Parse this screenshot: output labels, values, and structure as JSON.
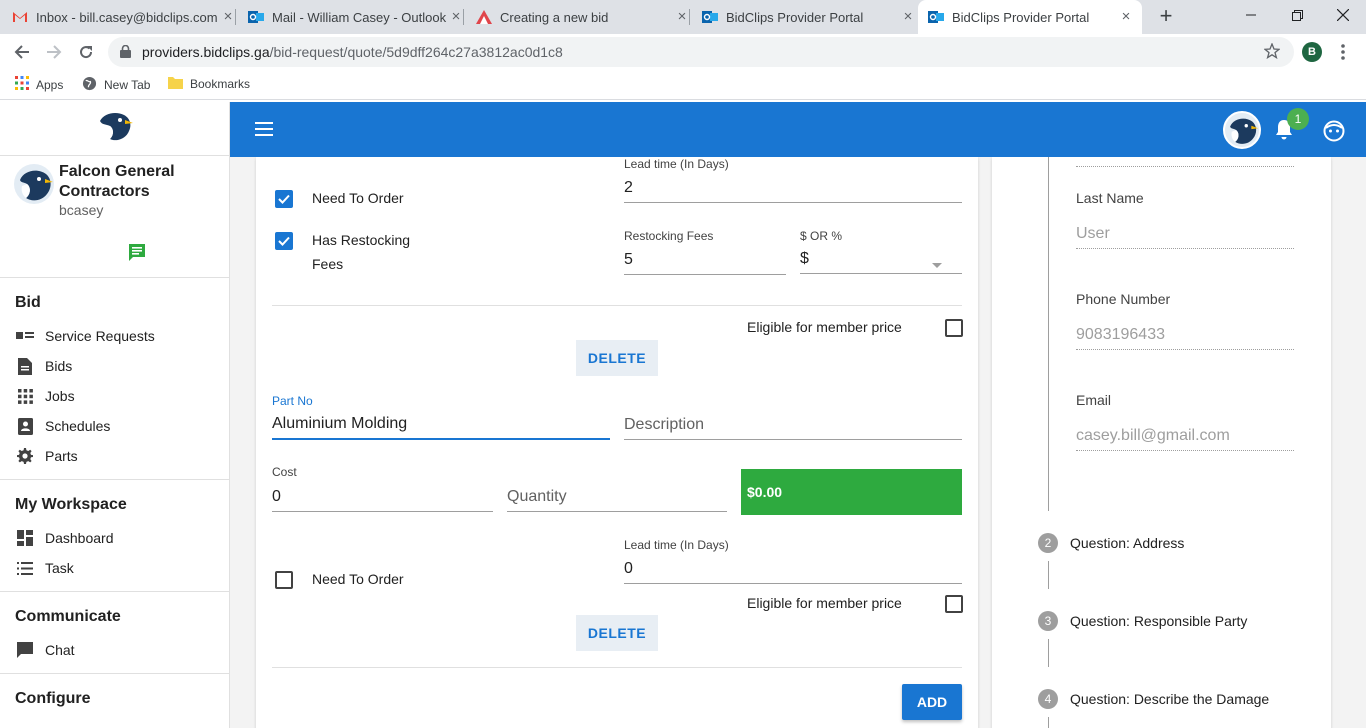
{
  "browser": {
    "tabs": [
      {
        "title": "Inbox - bill.casey@bidclips.com",
        "icon": "gmail-icon"
      },
      {
        "title": "Mail - William Casey - Outlook",
        "icon": "outlook-icon"
      },
      {
        "title": "Creating a new bid",
        "icon": "bidclips-icon"
      },
      {
        "title": "BidClips Provider Portal",
        "icon": "outlook-icon"
      },
      {
        "title": "BidClips Provider Portal",
        "icon": "outlook-icon"
      }
    ],
    "url_host": "providers.bidclips.ga",
    "url_path": "/bid-request/quote/5d9dff264c27a3812ac0d1c8",
    "profile_initial": "B",
    "bookmarks": {
      "apps": "Apps",
      "new_tab": "New Tab",
      "bookmarks": "Bookmarks"
    }
  },
  "sidebar": {
    "company": "Falcon General Contractors",
    "username": "bcasey",
    "sections": {
      "bid": {
        "heading": "Bid",
        "items": [
          "Service Requests",
          "Bids",
          "Jobs",
          "Schedules",
          "Parts"
        ]
      },
      "workspace": {
        "heading": "My Workspace",
        "items": [
          "Dashboard",
          "Task"
        ]
      },
      "communicate": {
        "heading": "Communicate",
        "items": [
          "Chat"
        ]
      },
      "configure": {
        "heading": "Configure"
      }
    }
  },
  "appbar": {
    "notification_count": "1"
  },
  "part1": {
    "lead_time_label": "Lead time (In Days)",
    "lead_time_value": "2",
    "need_to_order_label": "Need To Order",
    "need_to_order_checked": true,
    "restocking_label": "Has Restocking Fees",
    "restocking_checked": true,
    "restocking_fees_label": "Restocking Fees",
    "restocking_fees_value": "5",
    "fee_type_label": "$ OR %",
    "fee_type_value": "$",
    "eligible_label": "Eligible for member price",
    "delete_label": "DELETE"
  },
  "part2": {
    "part_no_label": "Part No",
    "part_no_value": "Aluminium Molding",
    "description_placeholder": "Description",
    "cost_label": "Cost",
    "cost_value": "0",
    "quantity_placeholder": "Quantity",
    "total": "$0.00",
    "lead_time_label": "Lead time (In Days)",
    "lead_time_value": "0",
    "need_to_order_label": "Need To Order",
    "need_to_order_checked": false,
    "eligible_label": "Eligible for member price",
    "delete_label": "DELETE"
  },
  "add_label": "ADD",
  "contact": {
    "last_name_label": "Last Name",
    "last_name_value": "User",
    "phone_label": "Phone Number",
    "phone_value": "9083196433",
    "email_label": "Email",
    "email_value": "casey.bill@gmail.com"
  },
  "steps": [
    {
      "num": "2",
      "label": "Question: Address"
    },
    {
      "num": "3",
      "label": "Question: Responsible Party"
    },
    {
      "num": "4",
      "label": "Question: Describe the Damage"
    }
  ],
  "colors": {
    "primary": "#1976d2",
    "success": "#2eaa3f",
    "badge": "#4caf50"
  }
}
